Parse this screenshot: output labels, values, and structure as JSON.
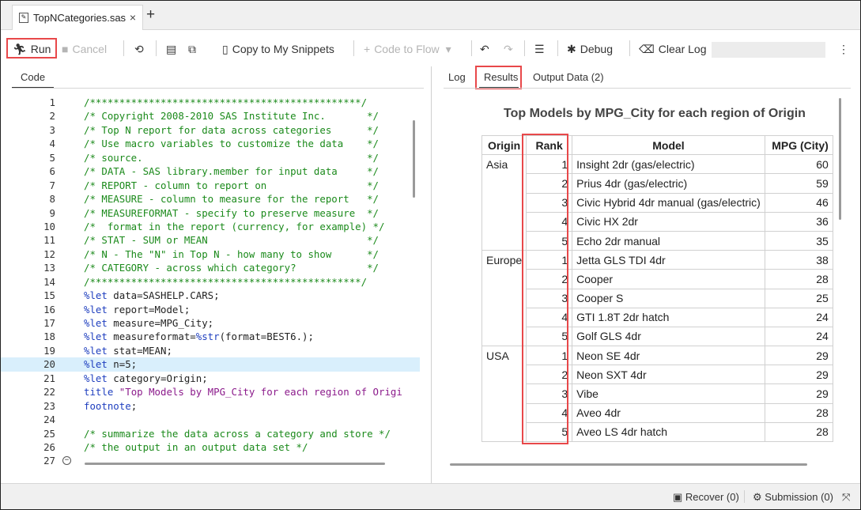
{
  "tab": {
    "title": "TopNCategories.sas",
    "close": "×",
    "add": "+"
  },
  "toolbar": {
    "run": "Run",
    "cancel": "Cancel",
    "copy_snippets": "Copy to My Snippets",
    "code_to_flow": "Code to Flow",
    "debug": "Debug",
    "clear_log": "Clear Log",
    "more": "⋮"
  },
  "left_tabs": {
    "code": "Code"
  },
  "right_tabs": {
    "log": "Log",
    "results": "Results",
    "output_data": "Output Data (2)"
  },
  "code_lines": [
    {
      "n": "1",
      "parts": [
        {
          "c": "cm",
          "t": "/**********************************************/"
        }
      ]
    },
    {
      "n": "2",
      "parts": [
        {
          "c": "cm",
          "t": "/* Copyright 2008-2010 SAS Institute Inc.       */"
        }
      ]
    },
    {
      "n": "3",
      "parts": [
        {
          "c": "cm",
          "t": "/* Top N report for data across categories      */"
        }
      ]
    },
    {
      "n": "4",
      "parts": [
        {
          "c": "cm",
          "t": "/* Use macro variables to customize the data    */"
        }
      ]
    },
    {
      "n": "5",
      "parts": [
        {
          "c": "cm",
          "t": "/* source.                                      */"
        }
      ]
    },
    {
      "n": "6",
      "parts": [
        {
          "c": "cm",
          "t": "/* DATA - SAS library.member for input data     */"
        }
      ]
    },
    {
      "n": "7",
      "parts": [
        {
          "c": "cm",
          "t": "/* REPORT - column to report on                 */"
        }
      ]
    },
    {
      "n": "8",
      "parts": [
        {
          "c": "cm",
          "t": "/* MEASURE - column to measure for the report   */"
        }
      ]
    },
    {
      "n": "9",
      "parts": [
        {
          "c": "cm",
          "t": "/* MEASUREFORMAT - specify to preserve measure  */"
        }
      ]
    },
    {
      "n": "10",
      "parts": [
        {
          "c": "cm",
          "t": "/*  format in the report (currency, for example) */"
        }
      ]
    },
    {
      "n": "11",
      "parts": [
        {
          "c": "cm",
          "t": "/* STAT - SUM or MEAN                           */"
        }
      ]
    },
    {
      "n": "12",
      "parts": [
        {
          "c": "cm",
          "t": "/* N - The \"N\" in Top N - how many to show      */"
        }
      ]
    },
    {
      "n": "13",
      "parts": [
        {
          "c": "cm",
          "t": "/* CATEGORY - across which category?            */"
        }
      ]
    },
    {
      "n": "14",
      "parts": [
        {
          "c": "cm",
          "t": "/**********************************************/"
        }
      ]
    },
    {
      "n": "15",
      "parts": [
        {
          "c": "kw",
          "t": "%let"
        },
        {
          "c": "tx",
          "t": " data=SASHELP.CARS;"
        }
      ]
    },
    {
      "n": "16",
      "parts": [
        {
          "c": "kw",
          "t": "%let"
        },
        {
          "c": "tx",
          "t": " report=Model;"
        }
      ]
    },
    {
      "n": "17",
      "parts": [
        {
          "c": "kw",
          "t": "%let"
        },
        {
          "c": "tx",
          "t": " measure=MPG_City;"
        }
      ]
    },
    {
      "n": "18",
      "parts": [
        {
          "c": "kw",
          "t": "%let"
        },
        {
          "c": "tx",
          "t": " measureformat="
        },
        {
          "c": "kw",
          "t": "%str"
        },
        {
          "c": "tx",
          "t": "(format=BEST6.);"
        }
      ]
    },
    {
      "n": "19",
      "parts": [
        {
          "c": "kw",
          "t": "%let"
        },
        {
          "c": "tx",
          "t": " stat=MEAN;"
        }
      ]
    },
    {
      "n": "20",
      "parts": [
        {
          "c": "kw",
          "t": "%let"
        },
        {
          "c": "tx",
          "t": " n=5;"
        }
      ],
      "highlight": true
    },
    {
      "n": "21",
      "parts": [
        {
          "c": "kw",
          "t": "%let"
        },
        {
          "c": "tx",
          "t": " category=Origin;"
        }
      ]
    },
    {
      "n": "22",
      "parts": [
        {
          "c": "kw",
          "t": "title"
        },
        {
          "c": "st",
          "t": " \"Top Models by MPG_City for each region of Origi"
        }
      ]
    },
    {
      "n": "23",
      "parts": [
        {
          "c": "kw",
          "t": "footnote"
        },
        {
          "c": "tx",
          "t": ";"
        }
      ]
    },
    {
      "n": "24",
      "parts": []
    },
    {
      "n": "25",
      "parts": [
        {
          "c": "cm",
          "t": "/* summarize the data across a category and store */"
        }
      ]
    },
    {
      "n": "26",
      "parts": [
        {
          "c": "cm",
          "t": "/* the output in an output data set */"
        }
      ]
    },
    {
      "n": "27",
      "parts": [],
      "fold": "−"
    }
  ],
  "results": {
    "title": "Top Models by MPG_City for each region of Origin",
    "headers": [
      "Origin",
      "Rank",
      "Model",
      "MPG (City)"
    ],
    "rows": [
      {
        "origin": "Asia",
        "rank": "1",
        "model": "Insight 2dr (gas/electric)",
        "mpg": "60"
      },
      {
        "origin": "",
        "rank": "2",
        "model": "Prius 4dr (gas/electric)",
        "mpg": "59"
      },
      {
        "origin": "",
        "rank": "3",
        "model": "Civic Hybrid 4dr manual (gas/electric)",
        "mpg": "46"
      },
      {
        "origin": "",
        "rank": "4",
        "model": "Civic HX 2dr",
        "mpg": "36"
      },
      {
        "origin": "",
        "rank": "5",
        "model": "Echo 2dr manual",
        "mpg": "35"
      },
      {
        "origin": "Europe",
        "rank": "1",
        "model": "Jetta GLS TDI 4dr",
        "mpg": "38"
      },
      {
        "origin": "",
        "rank": "2",
        "model": "Cooper",
        "mpg": "28"
      },
      {
        "origin": "",
        "rank": "3",
        "model": "Cooper S",
        "mpg": "25"
      },
      {
        "origin": "",
        "rank": "4",
        "model": "GTI 1.8T 2dr hatch",
        "mpg": "24"
      },
      {
        "origin": "",
        "rank": "5",
        "model": "Golf GLS 4dr",
        "mpg": "24"
      },
      {
        "origin": "USA",
        "rank": "1",
        "model": "Neon SE 4dr",
        "mpg": "29"
      },
      {
        "origin": "",
        "rank": "2",
        "model": "Neon SXT 4dr",
        "mpg": "29"
      },
      {
        "origin": "",
        "rank": "3",
        "model": "Vibe",
        "mpg": "29"
      },
      {
        "origin": "",
        "rank": "4",
        "model": "Aveo 4dr",
        "mpg": "28"
      },
      {
        "origin": "",
        "rank": "5",
        "model": "Aveo LS 4dr hatch",
        "mpg": "28"
      }
    ]
  },
  "statusbar": {
    "recover": "Recover (0)",
    "submission": "Submission (0)"
  },
  "colors": {
    "highlight_box": "#e8484a",
    "comment": "#1b8a1b",
    "keyword": "#1f3fbf",
    "current_line": "#d9effc"
  },
  "icons": [
    "file-sas-icon",
    "run-icon",
    "stop-icon",
    "refresh-icon",
    "format-icon",
    "snippet-icon",
    "copy-icon",
    "plus-icon",
    "undo-icon",
    "redo-icon",
    "align-icon",
    "bug-icon",
    "clear-icon",
    "more-icon",
    "recover-icon",
    "gear-icon",
    "expand-icon"
  ]
}
